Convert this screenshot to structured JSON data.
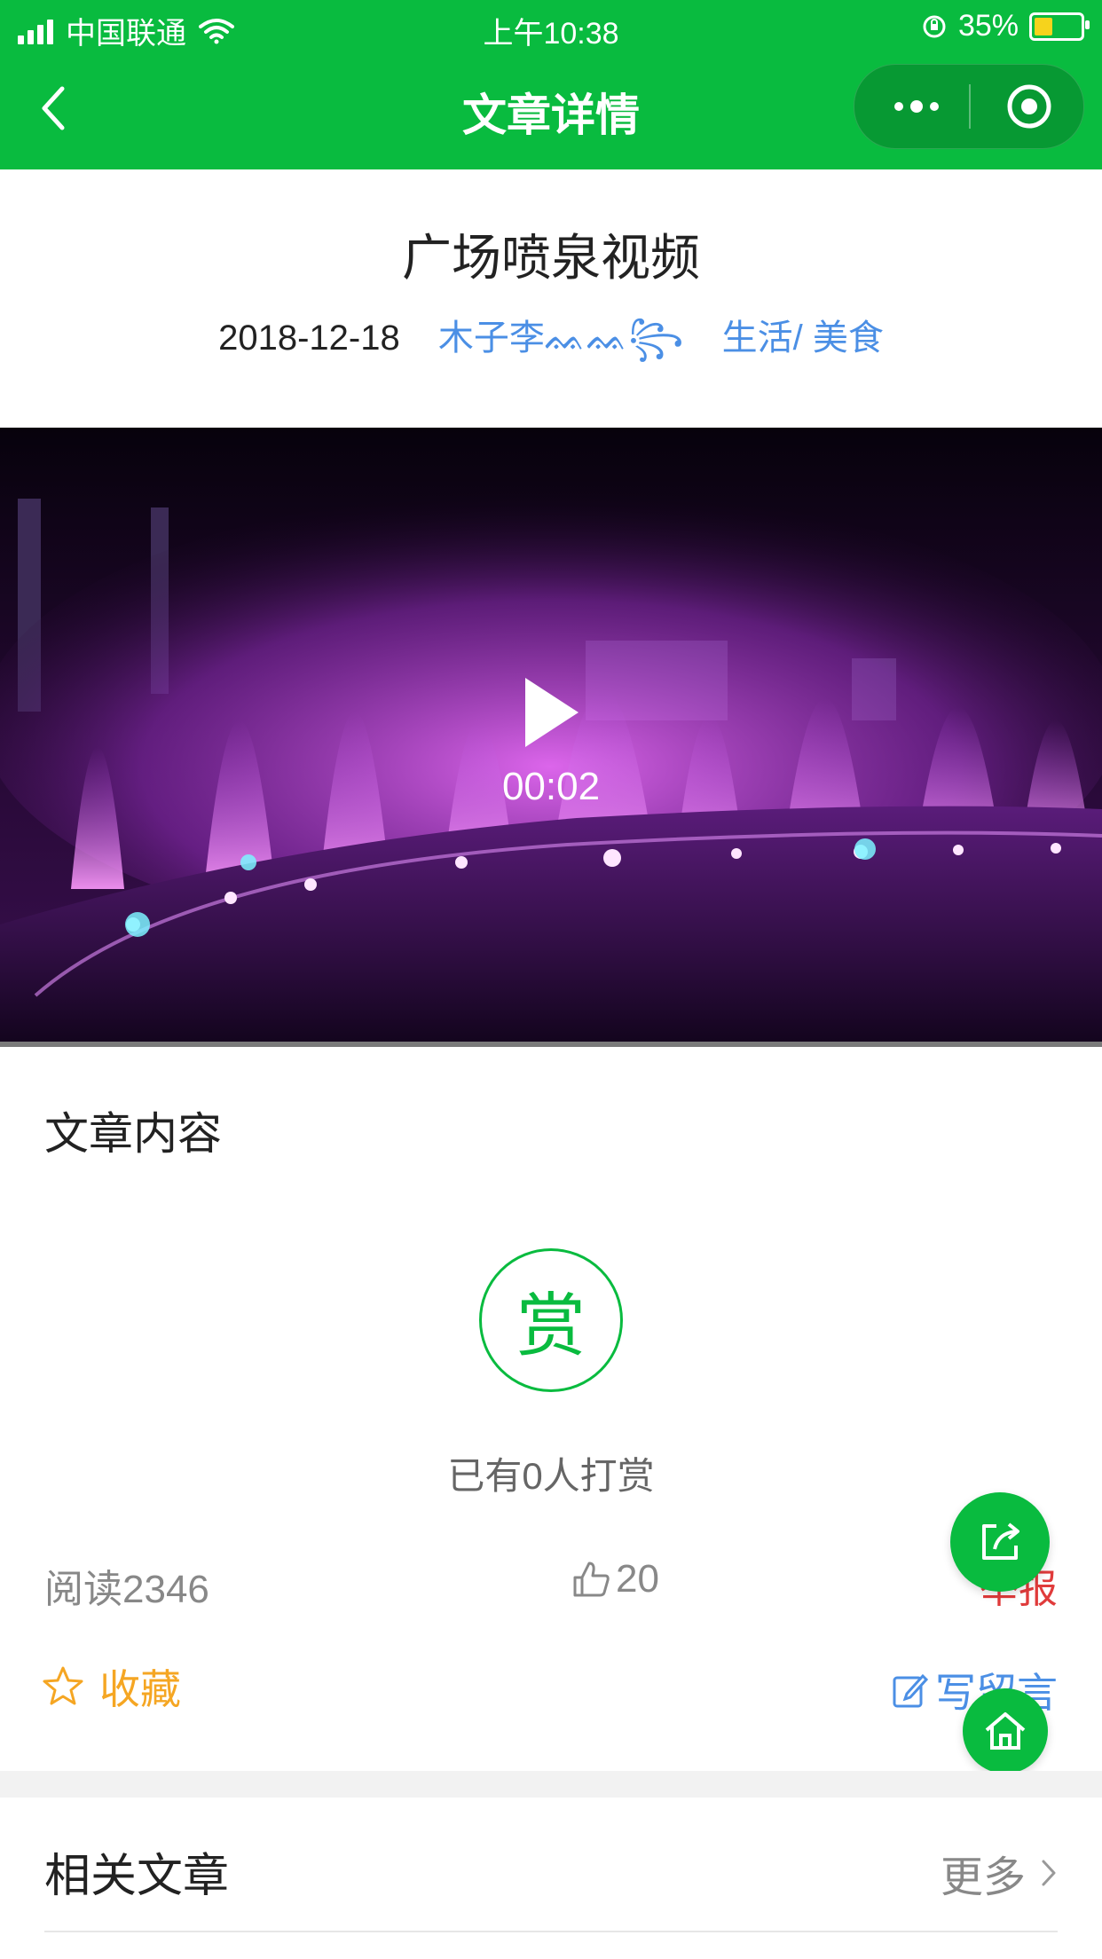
{
  "status_bar": {
    "carrier": "中国联通",
    "time": "上午10:38",
    "battery_percent": "35%"
  },
  "nav": {
    "title": "文章详情",
    "icons": [
      "chevron-left-icon",
      "more-dots-icon",
      "target-icon"
    ]
  },
  "article": {
    "title": "广场喷泉视频",
    "date": "2018-12-18",
    "author": "木子李ᨐᨐ꧂",
    "category": "生活/ 美食"
  },
  "video": {
    "duration": "00:02"
  },
  "content": {
    "section_title": "文章内容",
    "reward_glyph": "赏",
    "reward_text": "已有0人打赏"
  },
  "stats": {
    "reads": "阅读2346",
    "likes": "20",
    "report": "举报"
  },
  "actions": {
    "collect": "收藏",
    "comment": "写留言"
  },
  "related": {
    "title": "相关文章",
    "more": "更多"
  },
  "colors": {
    "brand_green": "#09bb3f",
    "link_blue": "#4b8fe5",
    "collect_orange": "#f5a623",
    "report_red": "#e03b3b"
  }
}
